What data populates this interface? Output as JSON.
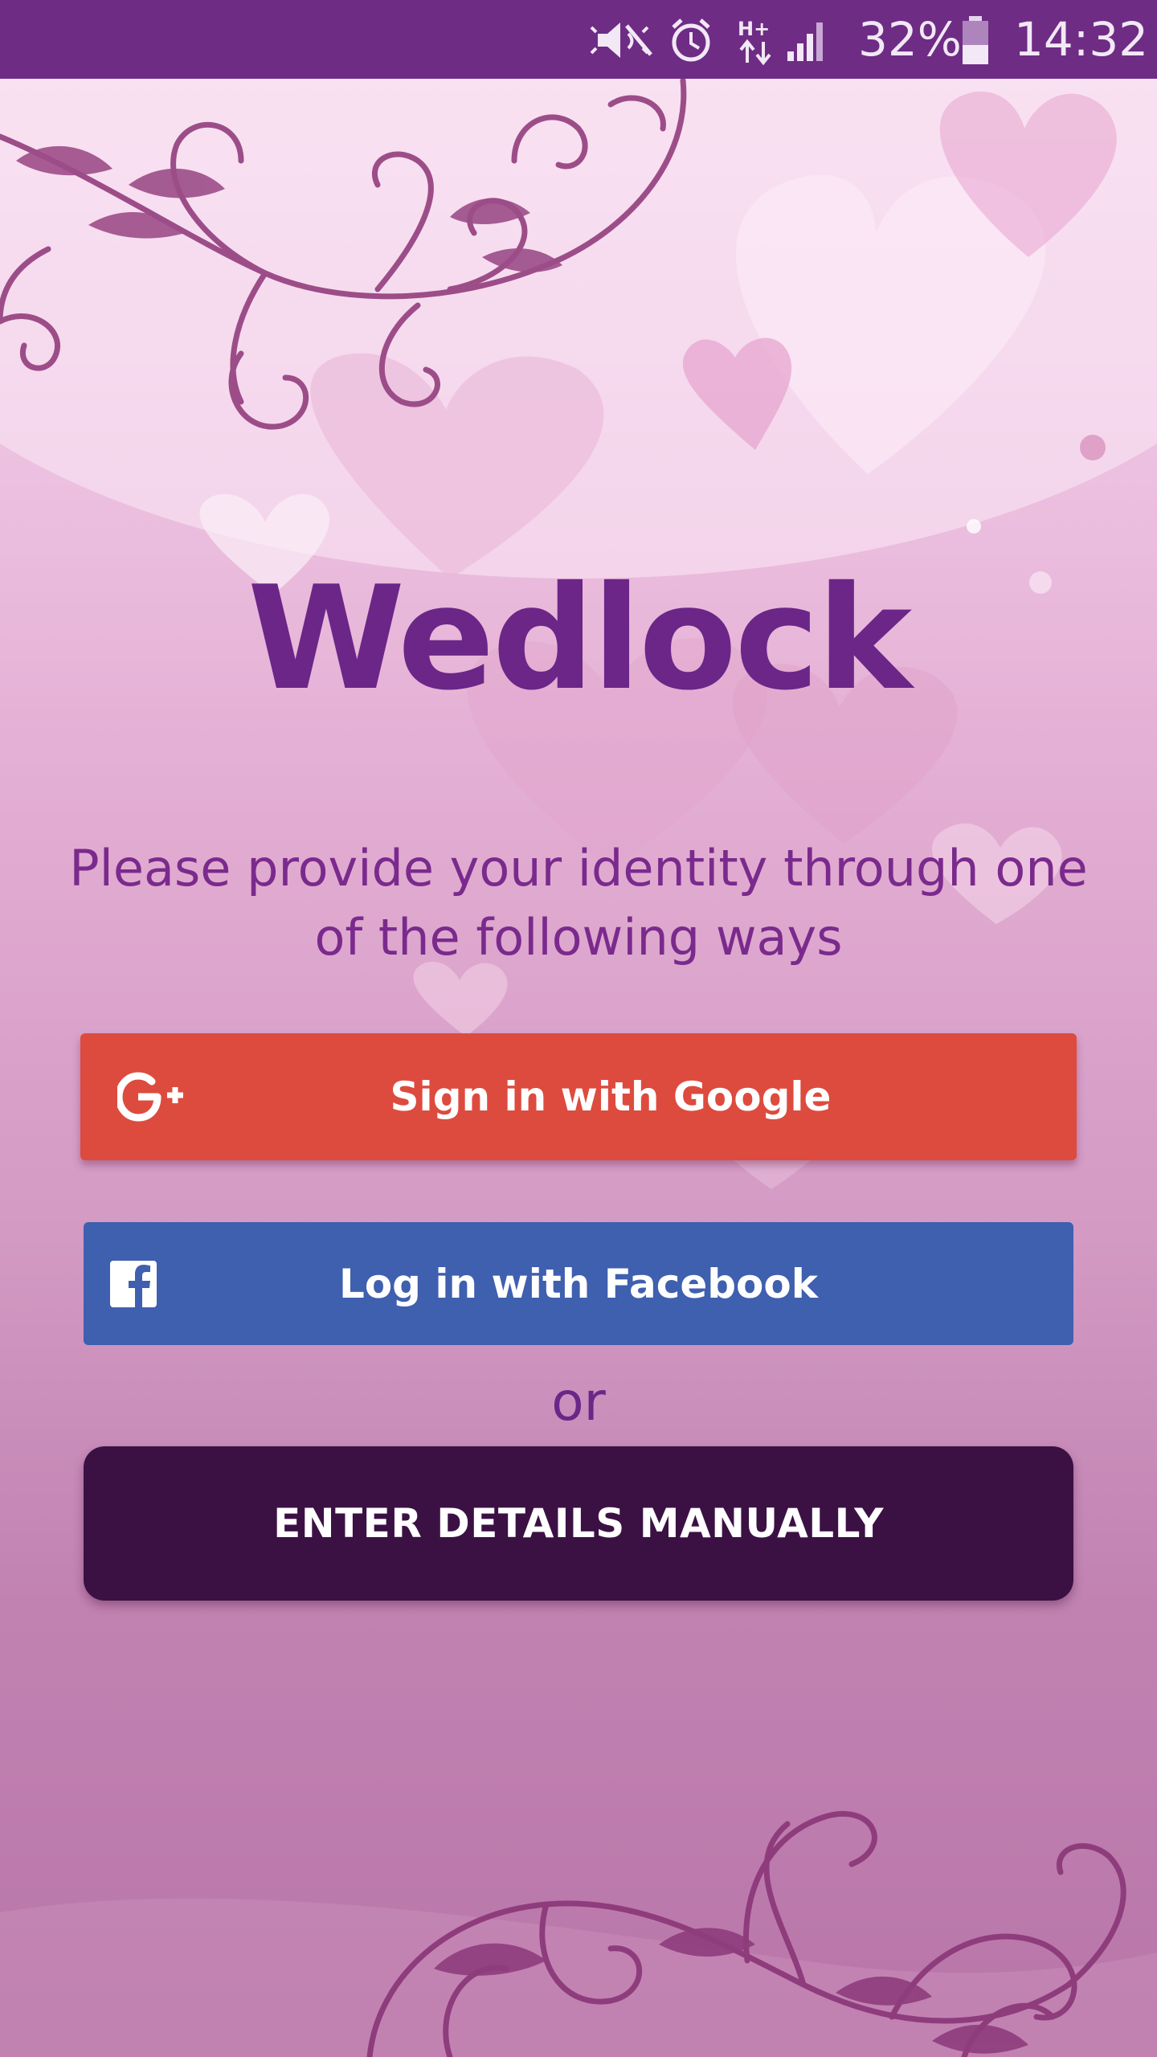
{
  "status_bar": {
    "battery": "32%",
    "time": "14:32",
    "icons": [
      "mute-icon",
      "alarm-icon",
      "hplus-network-icon",
      "signal-icon",
      "battery-icon"
    ]
  },
  "app": {
    "title": "Wedlock",
    "subtitle": "Please provide your identity through one of the following ways"
  },
  "buttons": {
    "google_label": "Sign in with Google",
    "google_icon_text": "G+",
    "facebook_label": "Log in with Facebook",
    "facebook_icon_text": "f",
    "or_text": "or",
    "manual_label": "ENTER DETAILS MANUALLY"
  },
  "colors": {
    "status_bar": "#6e2c85",
    "title": "#6b2688",
    "google": "#dd4b3e",
    "facebook": "#3f5faf",
    "manual": "#3b1144"
  }
}
